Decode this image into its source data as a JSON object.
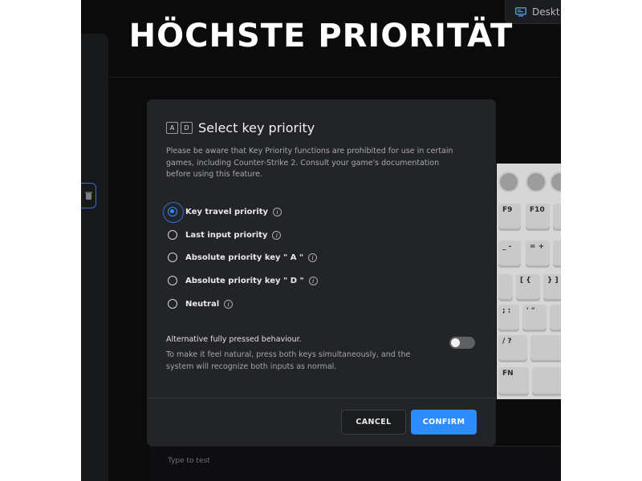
{
  "headline": "HÖCHSTE PRIORITÄT",
  "topbar": {
    "desktop_label": "Deskt"
  },
  "dialog": {
    "key_a": "A",
    "key_d": "D",
    "title": "Select key priority",
    "note": "Please be aware that Key Priority functions are prohibited for use in certain games, including Counter-Strike 2. Consult your game's documentation before using this feature.",
    "options": [
      {
        "label": "Key travel priority",
        "checked": true
      },
      {
        "label": "Last input priority",
        "checked": false
      },
      {
        "label": "Absolute priority key \" A \"",
        "checked": false
      },
      {
        "label": "Absolute priority key \" D \"",
        "checked": false
      },
      {
        "label": "Neutral",
        "checked": false
      }
    ],
    "info_glyph": "i",
    "alt_label": "Alternative fully pressed behaviour.",
    "alt_desc": "To make it feel natural, press both keys simultaneously, and the system will recognize both inputs as normal.",
    "toggle_on": false,
    "cancel_label": "CANCEL",
    "confirm_label": "CONFIRM"
  },
  "keyboard": {
    "keys": [
      "F9",
      "F10",
      "_ -",
      "= +",
      "[ {",
      "} ]",
      "; :",
      "' \"",
      "/ ?",
      "FN"
    ]
  },
  "test_field": {
    "placeholder": "Type to test"
  },
  "colors": {
    "accent": "#2d8cff",
    "dialog_bg": "#232427",
    "app_bg": "#0b0b0c"
  }
}
